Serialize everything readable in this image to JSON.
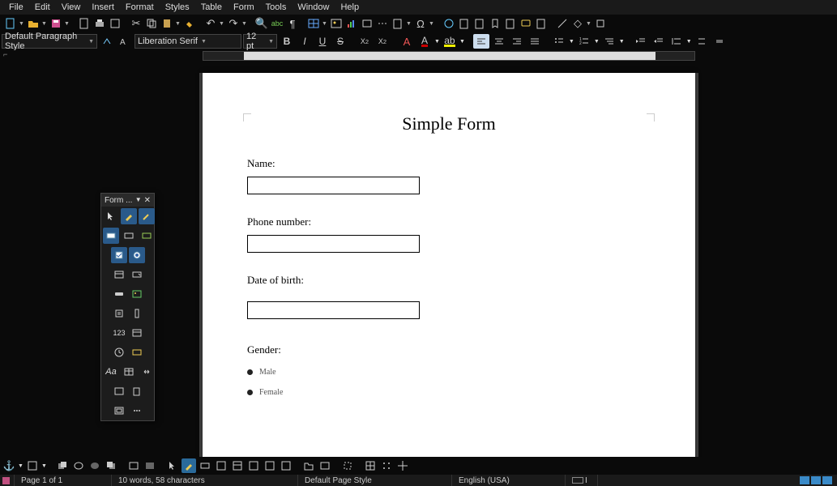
{
  "menu": [
    "File",
    "Edit",
    "View",
    "Insert",
    "Format",
    "Styles",
    "Table",
    "Form",
    "Tools",
    "Window",
    "Help"
  ],
  "fmt": {
    "para_style": "Default Paragraph Style",
    "font_name": "Liberation Serif",
    "font_size": "12 pt"
  },
  "doc": {
    "title": "Simple Form",
    "name_label": "Name:",
    "phone_label": "Phone number:",
    "dob_label": "Date of birth:",
    "gender_label": "Gender:",
    "radio_male": "Male",
    "radio_female": "Female"
  },
  "form_panel": {
    "title": "Form ..."
  },
  "status": {
    "page": "Page 1 of 1",
    "words": "10 words, 58 characters",
    "page_style": "Default Page Style",
    "lang": "English (USA)"
  }
}
